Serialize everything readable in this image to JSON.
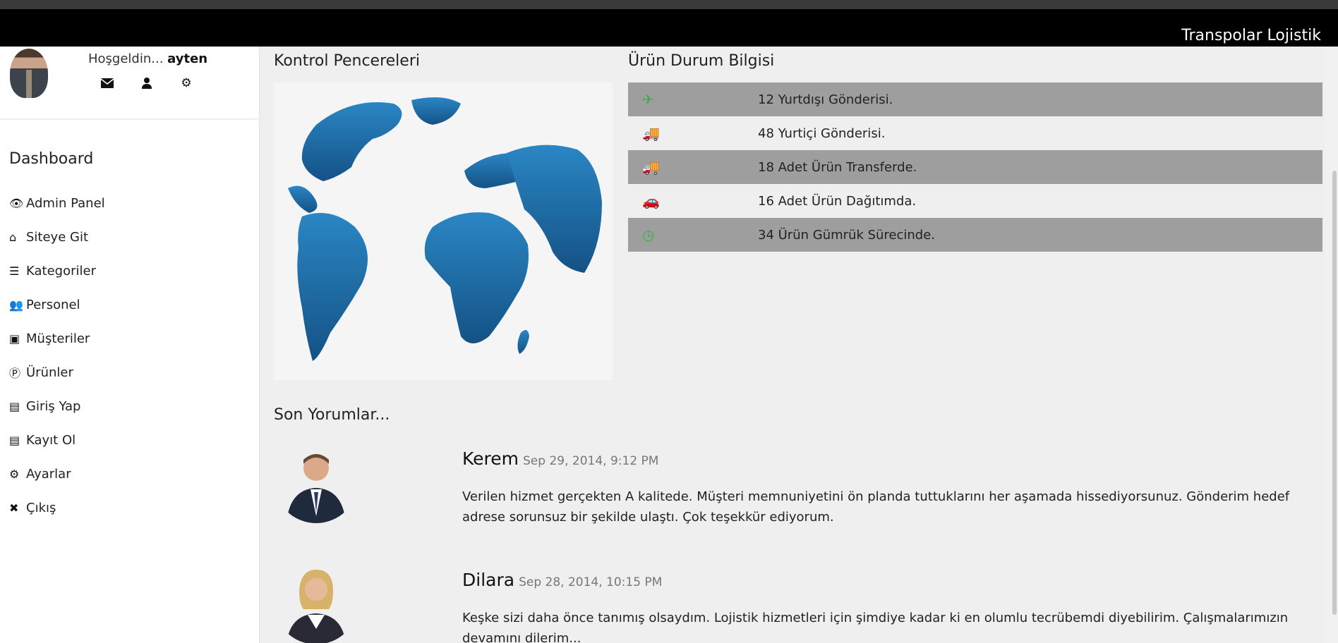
{
  "header": {
    "brand": "Transpolar Lojistik"
  },
  "profile": {
    "greeting": "Hoşgeldin...",
    "username": "ayten"
  },
  "sidebar": {
    "title": "Dashboard",
    "items": [
      {
        "label": "Admin Panel",
        "icon": "eye-icon",
        "glyph": "👁"
      },
      {
        "label": "Siteye Git",
        "icon": "home-icon",
        "glyph": "⌂"
      },
      {
        "label": "Kategoriler",
        "icon": "list-icon",
        "glyph": "☰"
      },
      {
        "label": "Personel",
        "icon": "users-icon",
        "glyph": "👥"
      },
      {
        "label": "Müşteriler",
        "icon": "contact-card-icon",
        "glyph": "▣"
      },
      {
        "label": "Ürünler",
        "icon": "product-p-icon",
        "glyph": "Ⓟ"
      },
      {
        "label": "Giriş Yap",
        "icon": "id-card-icon",
        "glyph": "▤"
      },
      {
        "label": "Kayıt Ol",
        "icon": "register-card-icon",
        "glyph": "▤"
      },
      {
        "label": "Ayarlar",
        "icon": "cogs-icon",
        "glyph": "⚙"
      },
      {
        "label": "Çıkış",
        "icon": "close-icon",
        "glyph": "✖"
      }
    ]
  },
  "sections": {
    "control": "Kontrol Pencereleri",
    "status": "Ürün Durum Bilgisi",
    "comments": "Son Yorumlar..."
  },
  "status_items": [
    {
      "text": "12 Yurtdışı Gönderisi.",
      "icon": "plane-icon",
      "color": "#3fae49"
    },
    {
      "text": "48 Yurtiçi Gönderisi.",
      "icon": "truck-icon",
      "color": "#e53a2e"
    },
    {
      "text": "18 Adet Ürün Transferde.",
      "icon": "truck-icon",
      "color": "#3fae49"
    },
    {
      "text": "16 Adet Ürün Dağıtımda.",
      "icon": "car-icon",
      "color": "#e53a2e"
    },
    {
      "text": "34 Ürün Gümrük Sürecinde.",
      "icon": "clock-icon",
      "color": "#3fae49"
    }
  ],
  "comments": [
    {
      "name": "Kerem",
      "date": "Sep 29, 2014, 9:12 PM",
      "text": "Verilen hizmet gerçekten A kalitede. Müşteri memnuniyetini ön planda tuttuklarını her aşamada hissediyorsunuz. Gönderim hedef adrese sorunsuz bir şekilde ulaştı. Çok teşekkür ediyorum."
    },
    {
      "name": "Dilara",
      "date": "Sep 28, 2014, 10:15 PM",
      "text": "Keşke sizi daha önce tanımış olsaydım. Lojistik hizmetleri için şimdiye kadar ki en olumlu tecrübemdi diyebilirim. Çalışmalarımızın devamını dilerim..."
    }
  ],
  "colors": {
    "accent_green": "#3fae49",
    "accent_red": "#e53a2e",
    "globe_blue": "#1f6fa6"
  }
}
